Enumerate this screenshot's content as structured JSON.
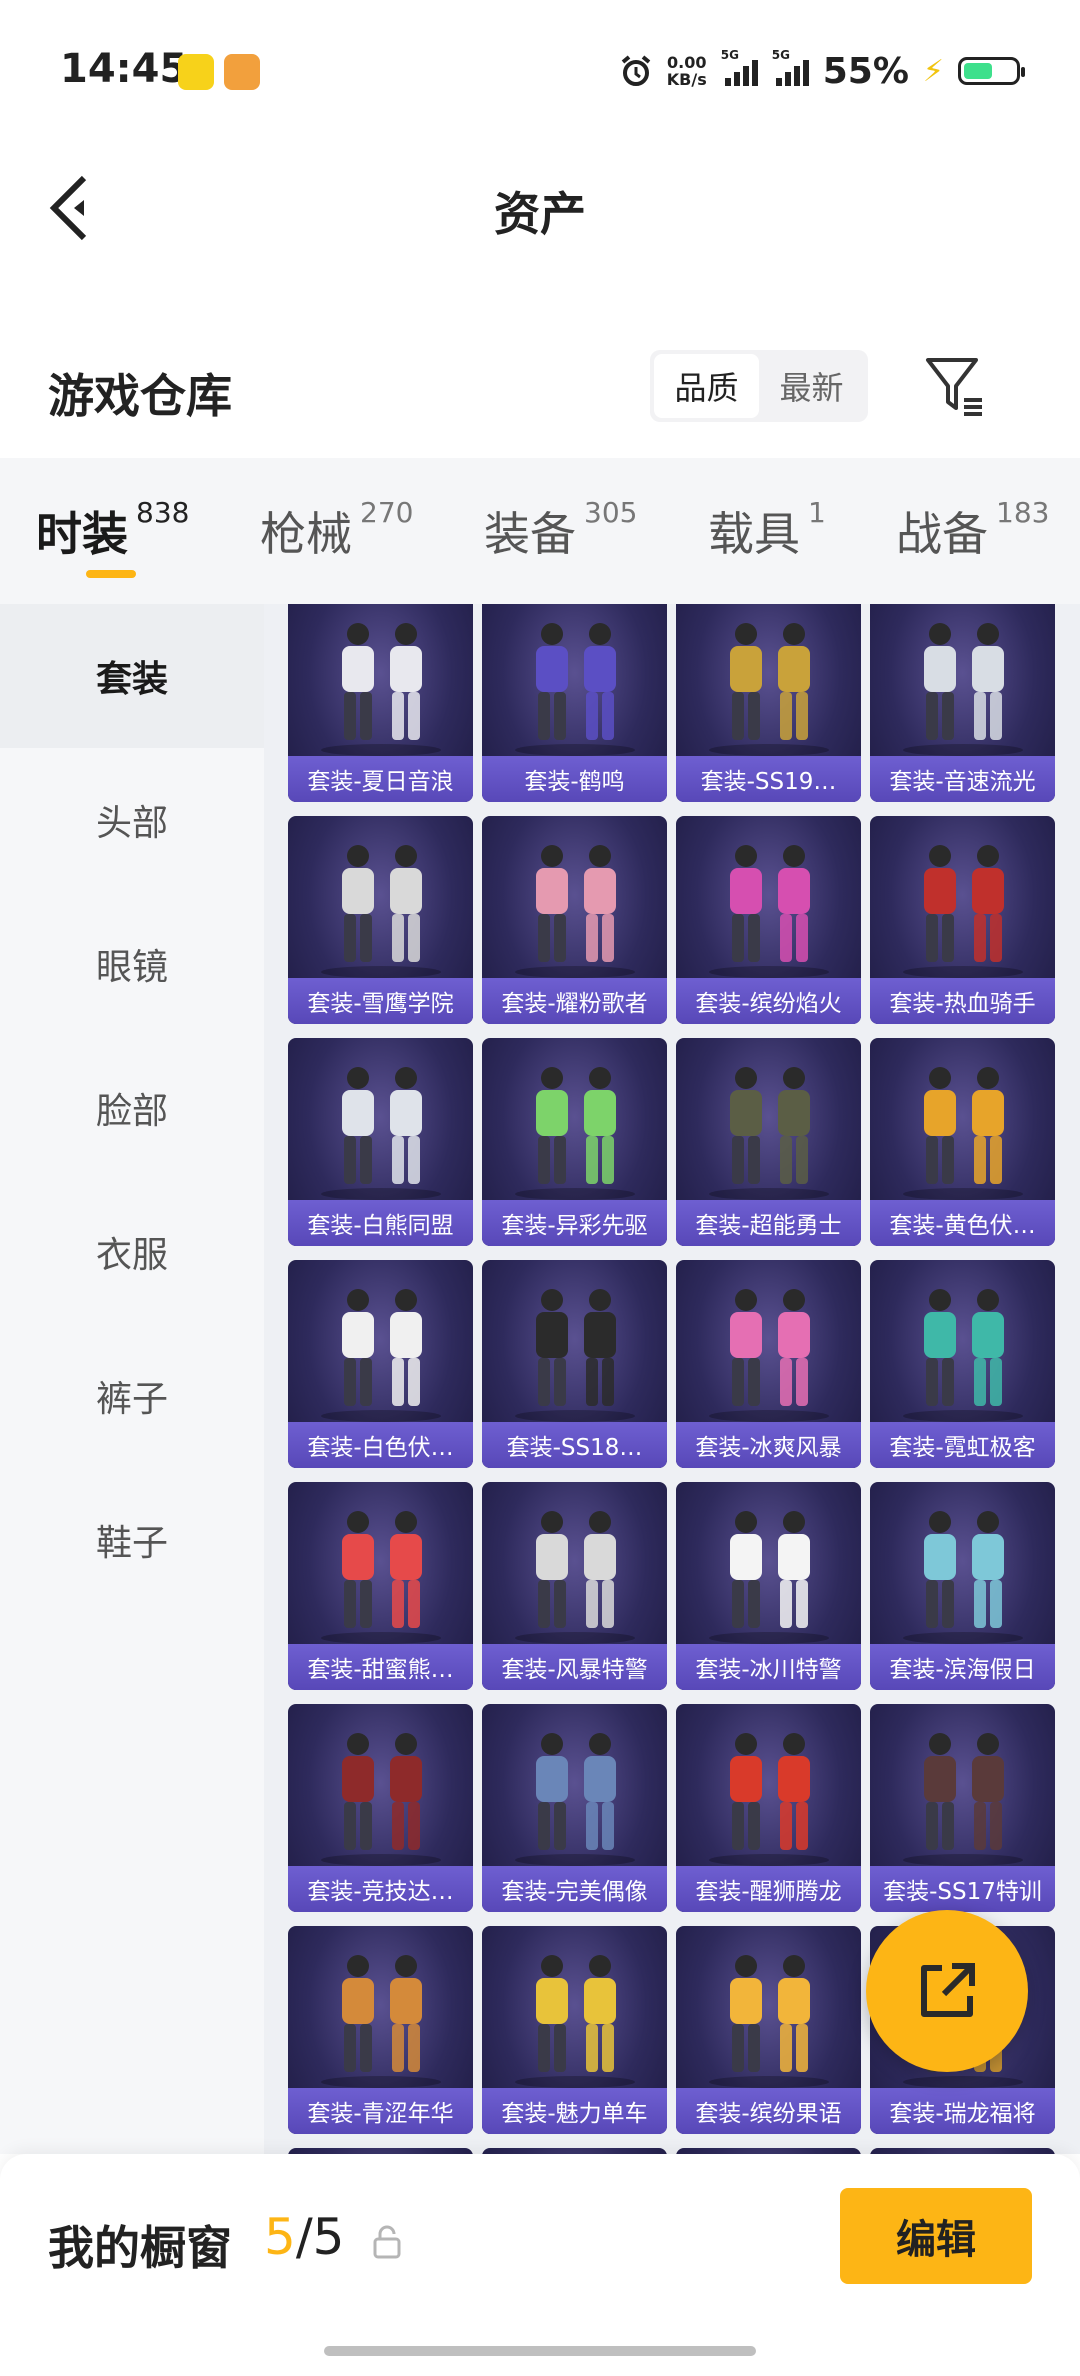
{
  "status_bar": {
    "time": "14:45",
    "net_speed_value": "0.00",
    "net_speed_unit": "KB/s",
    "signal1_label": "5G",
    "signal2_label": "5G",
    "battery_percent": "55%"
  },
  "nav": {
    "title": "资产"
  },
  "section": {
    "title": "游戏仓库",
    "sort_options": [
      "品质",
      "最新"
    ]
  },
  "tabs": [
    {
      "label": "时装",
      "count": "838"
    },
    {
      "label": "枪械",
      "count": "270"
    },
    {
      "label": "装备",
      "count": "305"
    },
    {
      "label": "载具",
      "count": "1"
    },
    {
      "label": "战备",
      "count": "183"
    }
  ],
  "sidebar": {
    "items": [
      "套装",
      "头部",
      "眼镜",
      "脸部",
      "衣服",
      "裤子",
      "鞋子"
    ]
  },
  "items": [
    "套装-夏日音浪",
    "套装-鹤鸣",
    "套装-SS19…",
    "套装-音速流光",
    "套装-雪鹰学院",
    "套装-耀粉歌者",
    "套装-缤纷焰火",
    "套装-热血骑手",
    "套装-白熊同盟",
    "套装-异彩先驱",
    "套装-超能勇士",
    "套装-黄色伏…",
    "套装-白色伏…",
    "套装-SS18…",
    "套装-冰爽风暴",
    "套装-霓虹极客",
    "套装-甜蜜熊…",
    "套装-风暴特警",
    "套装-冰川特警",
    "套装-滨海假日",
    "套装-竞技达…",
    "套装-完美偶像",
    "套装-醒狮腾龙",
    "套装-SS17特训",
    "套装-青涩年华",
    "套装-魅力单车",
    "套装-缤纷果语",
    "套装-瑞龙福将"
  ],
  "item_colors": [
    "#e8e8ee",
    "#5b4fc4",
    "#c9a23a",
    "#d8dde4",
    "#d9d9d9",
    "#e59ab0",
    "#d64fb0",
    "#c0302c",
    "#dfe3ea",
    "#7dd36a",
    "#5b5e45",
    "#e7a42a",
    "#f0f0f0",
    "#2b2b2b",
    "#e56fb3",
    "#3fb8a8",
    "#e64a4a",
    "#d9d9d9",
    "#f4f4f4",
    "#7ec8d8",
    "#8e2a2a",
    "#6a86b8",
    "#d93a2a",
    "#5a3a3a",
    "#d48a3a",
    "#e8c33a",
    "#f2b53a",
    "#d9a02a"
  ],
  "footer": {
    "showcase_label": "我的橱窗",
    "used": "5",
    "separator": "/",
    "total": "5",
    "edit_label": "编辑"
  },
  "colors": {
    "accent": "#fdb515",
    "card_label_bg": "#5848b8"
  }
}
